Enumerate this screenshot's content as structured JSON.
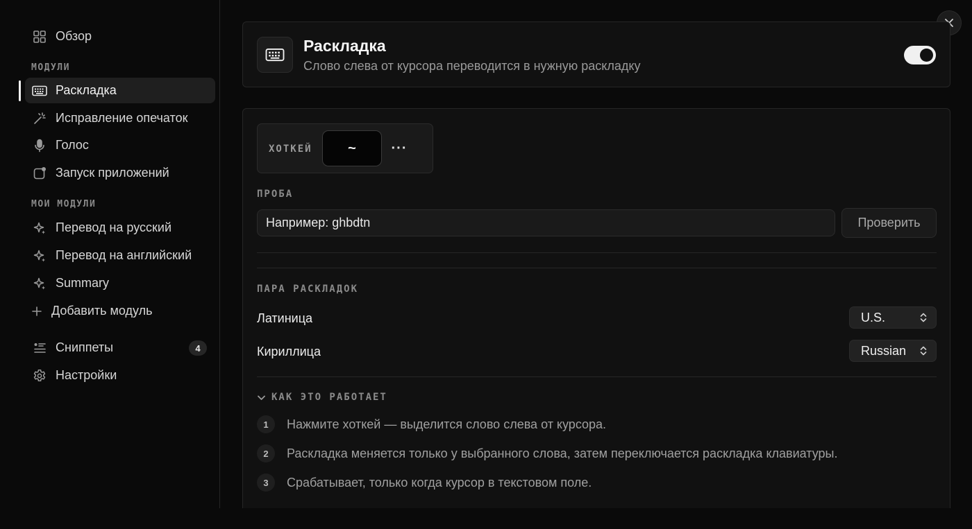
{
  "sidebar": {
    "overview": "Обзор",
    "modules_label": "МОДУЛИ",
    "modules": [
      {
        "label": "Раскладка",
        "icon": "keyboard-icon"
      },
      {
        "label": "Исправление опечаток",
        "icon": "magic-wand-icon"
      },
      {
        "label": "Голос",
        "icon": "microphone-icon"
      },
      {
        "label": "Запуск приложений",
        "icon": "app-launch-icon"
      }
    ],
    "my_modules_label": "МОИ МОДУЛИ",
    "my_modules": [
      {
        "label": "Перевод на русский",
        "icon": "sparkle-icon"
      },
      {
        "label": "Перевод на английский",
        "icon": "sparkle-icon"
      },
      {
        "label": "Summary",
        "icon": "sparkle-icon"
      }
    ],
    "add_module": "Добавить модуль",
    "snippets": "Сниппеты",
    "snippets_count": "4",
    "settings": "Настройки"
  },
  "header": {
    "title": "Раскладка",
    "subtitle": "Слово слева от курсора переводится в нужную раскладку",
    "enabled": true
  },
  "hotkey": {
    "label": "ХОТКЕЙ",
    "key": "~",
    "more": "···"
  },
  "test": {
    "label": "ПРОБА",
    "value": "Например: ghbdtn",
    "button": "Проверить"
  },
  "layouts": {
    "label": "ПАРА РАСКЛАДОК",
    "latin_label": "Латиница",
    "latin_value": "U.S.",
    "cyrillic_label": "Кириллица",
    "cyrillic_value": "Russian"
  },
  "how": {
    "label": "КАК ЭТО РАБОТАЕТ",
    "steps": [
      {
        "num": "1",
        "text": "Нажмите хоткей — выделится слово слева от курсора."
      },
      {
        "num": "2",
        "text": "Раскладка меняется только у выбранного слова, затем переключается раскладка клавиатуры."
      },
      {
        "num": "3",
        "text": "Срабатывает, только когда курсор в текстовом поле."
      }
    ]
  }
}
